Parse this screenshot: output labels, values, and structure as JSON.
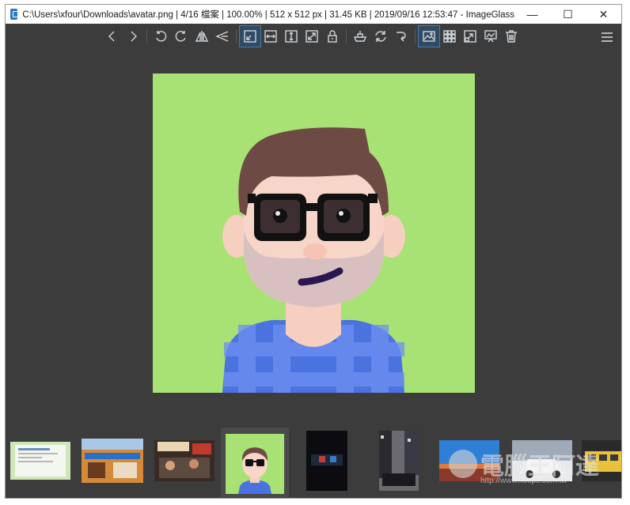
{
  "window": {
    "title": "C:\\Users\\xfour\\Downloads\\avatar.png  |  4/16 檔案  |  100.00%  |  512 x 512 px  |  31.45 KB  |  2019/09/16 12:53:47  - ImageGlass",
    "minimize_glyph": "—",
    "maximize_glyph": "☐",
    "close_glyph": "✕"
  },
  "toolbar": {
    "buttons": [
      {
        "name": "previous-image",
        "icon": "chevron-left-icon"
      },
      {
        "name": "next-image",
        "icon": "chevron-right-icon"
      },
      {
        "name": "rotate-left",
        "icon": "rotate-left-icon"
      },
      {
        "name": "rotate-right",
        "icon": "rotate-right-icon"
      },
      {
        "name": "flip-horizontal",
        "icon": "flip-horizontal-icon"
      },
      {
        "name": "flip-vertical",
        "icon": "flip-vertical-icon"
      },
      {
        "name": "auto-zoom",
        "icon": "auto-zoom-icon",
        "active": true
      },
      {
        "name": "scale-to-width",
        "icon": "scale-width-icon"
      },
      {
        "name": "scale-to-height",
        "icon": "scale-height-icon"
      },
      {
        "name": "scale-to-fit",
        "icon": "scale-fit-icon"
      },
      {
        "name": "lock-zoom",
        "icon": "lock-icon"
      },
      {
        "name": "open-with",
        "icon": "open-with-icon"
      },
      {
        "name": "refresh",
        "icon": "refresh-icon"
      },
      {
        "name": "go-to",
        "icon": "go-to-icon"
      },
      {
        "name": "thumbnail-bar",
        "icon": "image-icon",
        "active": true
      },
      {
        "name": "checkerboard",
        "icon": "grid-icon"
      },
      {
        "name": "fullscreen",
        "icon": "fullscreen-icon"
      },
      {
        "name": "slideshow",
        "icon": "slideshow-icon"
      },
      {
        "name": "delete",
        "icon": "trash-icon"
      }
    ],
    "menu_icon": "hamburger-icon"
  },
  "viewer": {
    "background_color": "#a8e174",
    "image_icon": "avatar-illustration"
  },
  "thumbnails": {
    "selected_index": 3,
    "items": [
      {
        "name": "thumb-document"
      },
      {
        "name": "thumb-storefront"
      },
      {
        "name": "thumb-restaurant"
      },
      {
        "name": "thumb-avatar"
      },
      {
        "name": "thumb-dark-room"
      },
      {
        "name": "thumb-city-street"
      },
      {
        "name": "thumb-landscape"
      },
      {
        "name": "thumb-car"
      },
      {
        "name": "thumb-train"
      }
    ]
  },
  "watermark": {
    "text": "電腦王阿達",
    "url": "http://www.kocpc.com.tw"
  },
  "colors": {
    "app_background": "#3c3c3c",
    "accent": "#2b78c5"
  }
}
